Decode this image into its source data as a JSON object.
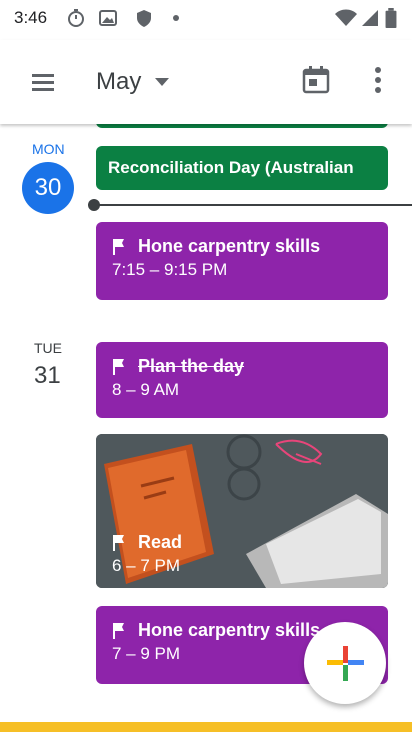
{
  "status": {
    "time": "3:46"
  },
  "header": {
    "month": "May"
  },
  "days": [
    {
      "name": "MON",
      "number": "30"
    },
    {
      "name": "TUE",
      "number": "31"
    }
  ],
  "events": {
    "prev_partial": {
      "title": ""
    },
    "holiday": {
      "title": "Reconciliation Day (Australian"
    },
    "carpentry1": {
      "title": "Hone carpentry skills",
      "time": "7:15 – 9:15 PM"
    },
    "plan": {
      "title": "Plan the day",
      "time": "8 – 9 AM"
    },
    "read": {
      "title": "Read",
      "time": "6 – 7 PM"
    },
    "carpentry2": {
      "title": "Hone carpentry skills",
      "time": "7 – 9 PM"
    }
  },
  "colors": {
    "event_purple": "#8e24aa",
    "holiday_green": "#0b8043",
    "today_blue": "#1a73e8"
  }
}
